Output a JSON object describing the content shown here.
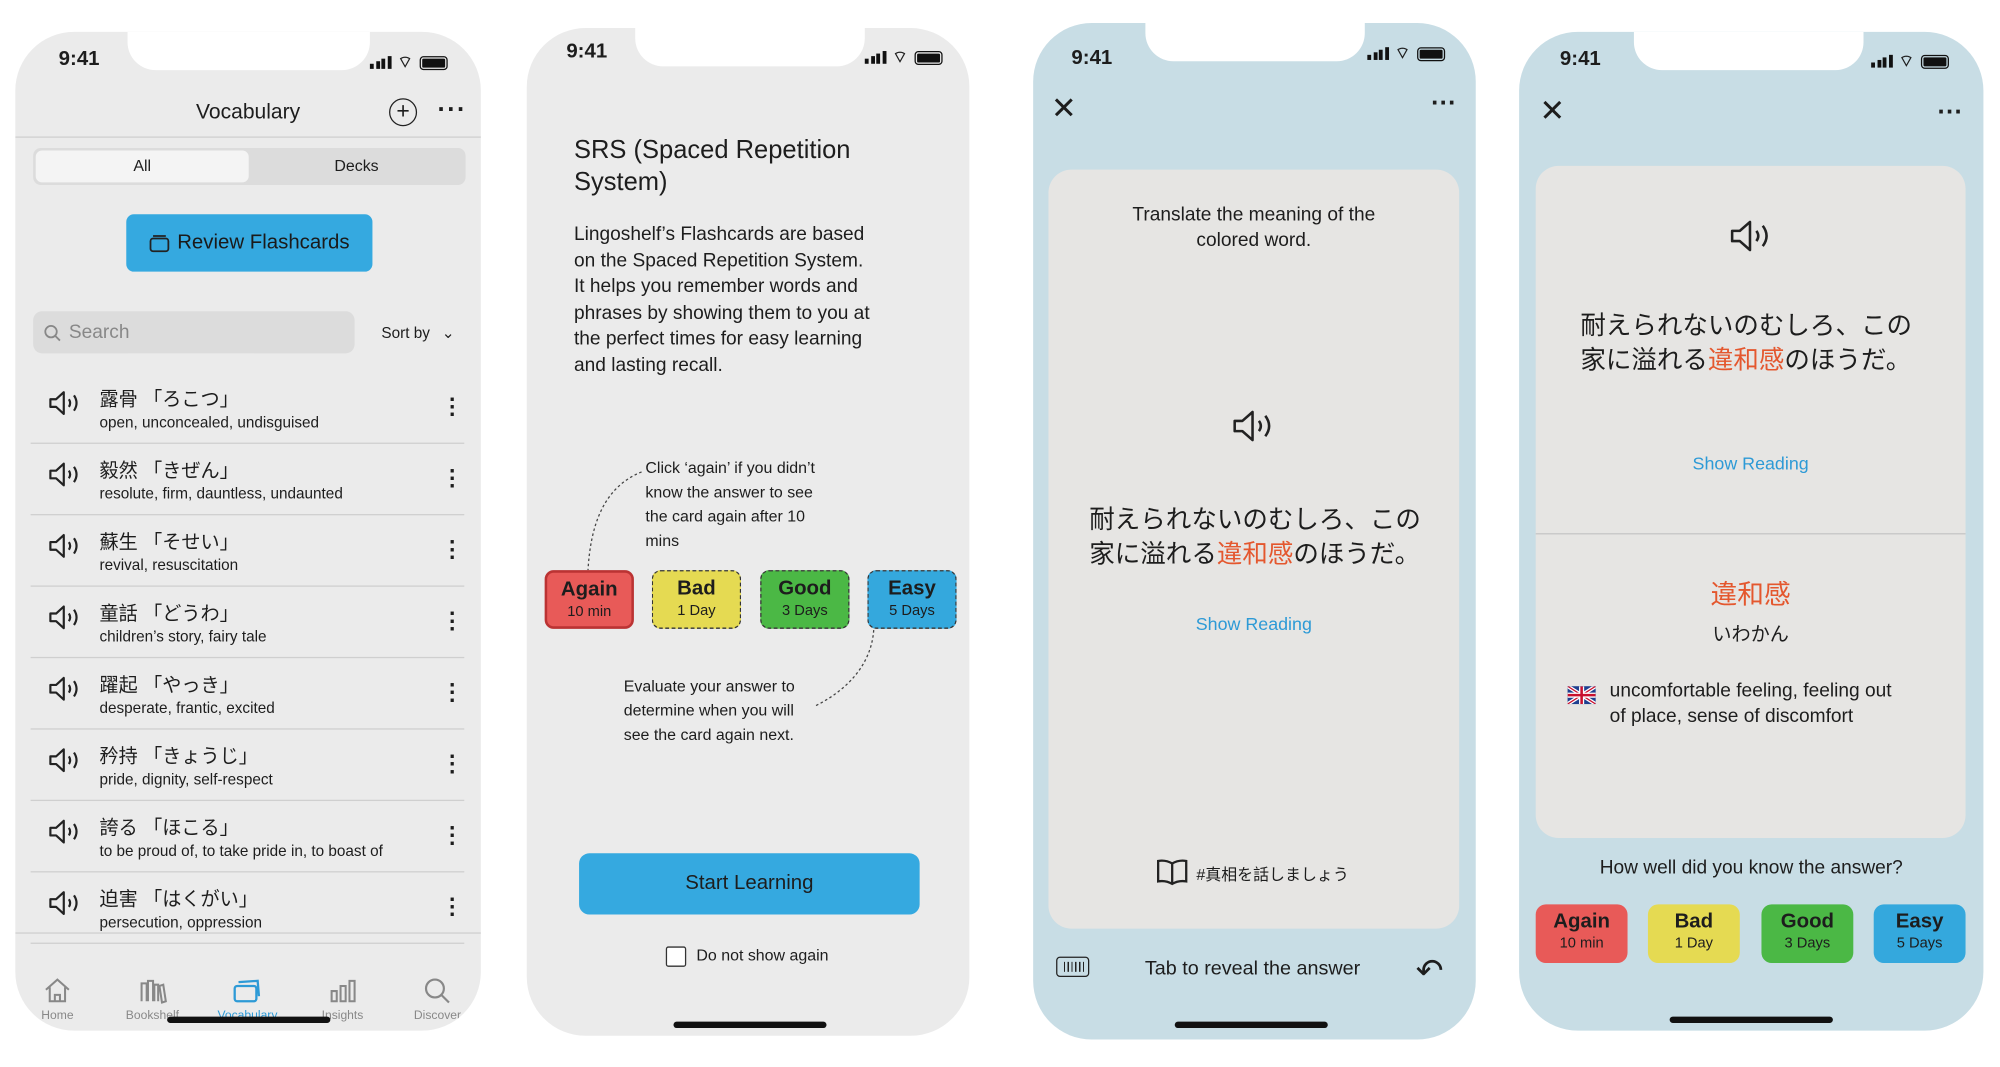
{
  "status_time": "9:41",
  "vocab_screen": {
    "title": "Vocabulary",
    "segments": [
      "All",
      "Decks"
    ],
    "review_button": "Review Flashcards",
    "search_placeholder": "Search",
    "sort_label": "Sort by",
    "items": [
      {
        "word": "露骨 「ろこつ」",
        "meaning": "open, unconcealed, undisguised"
      },
      {
        "word": "毅然 「きぜん」",
        "meaning": "resolute, firm, dauntless, undaunted"
      },
      {
        "word": "蘇生 「そせい」",
        "meaning": "revival, resuscitation"
      },
      {
        "word": "童話 「どうわ」",
        "meaning": "children’s story, fairy tale"
      },
      {
        "word": "躍起 「やっき」",
        "meaning": "desperate, frantic, excited"
      },
      {
        "word": "矜持 「きょうじ」",
        "meaning": "pride, dignity, self-respect"
      },
      {
        "word": "誇る 「ほこる」",
        "meaning": "to be proud of, to take pride in, to boast of"
      },
      {
        "word": "迫害 「はくがい」",
        "meaning": "persecution, oppression"
      }
    ],
    "tabs": [
      "Home",
      "Bookshelf",
      "Vocabulary",
      "Insights",
      "Discover"
    ],
    "active_tab": "Vocabulary",
    "accent": "#35a9e0"
  },
  "srs_screen": {
    "title_line1": "SRS (Spaced Repetition",
    "title_line2": "System)",
    "paragraph": [
      "Lingoshelf’s Flashcards are based",
      "on the Spaced Repetition System.",
      "It helps you remember words and",
      "phrases by showing them to you at",
      "the perfect times for easy learning",
      "and lasting recall."
    ],
    "note_top": [
      "Click ‘again’ if you didn’t",
      "know the answer to see",
      "the card again after 10",
      "mins"
    ],
    "note_bottom": [
      "Evaluate your answer to",
      "determine when you will",
      "see the card again next."
    ],
    "start_button": "Start Learning",
    "checkbox_label": "Do not show again",
    "checkbox_checked": false
  },
  "ratings": [
    {
      "label": "Again",
      "interval": "10 min",
      "color": "#e85a58"
    },
    {
      "label": "Bad",
      "interval": "1 Day",
      "color": "#e5da52"
    },
    {
      "label": "Good",
      "interval": "3 Days",
      "color": "#4bb845"
    },
    {
      "label": "Easy",
      "interval": "5 Days",
      "color": "#34a8dd"
    }
  ],
  "card_front": {
    "instruction_line1": "Translate the meaning of the",
    "instruction_line2": "colored word.",
    "sentence_line1": "耐えられないのむしろ、この",
    "sentence_pre": "家に溢れる",
    "sentence_highlight": "違和感",
    "sentence_post": "のほうだ。",
    "show_reading": "Show Reading",
    "tag": "#真相を話しましょう",
    "reveal_hint": "Tab to reveal the answer"
  },
  "card_back": {
    "word": "違和感",
    "reading": "いわかん",
    "meaning_line1": "uncomfortable feeling, feeling out",
    "meaning_line2": "of place, sense of discomfort",
    "question": "How well did you know the answer?"
  }
}
